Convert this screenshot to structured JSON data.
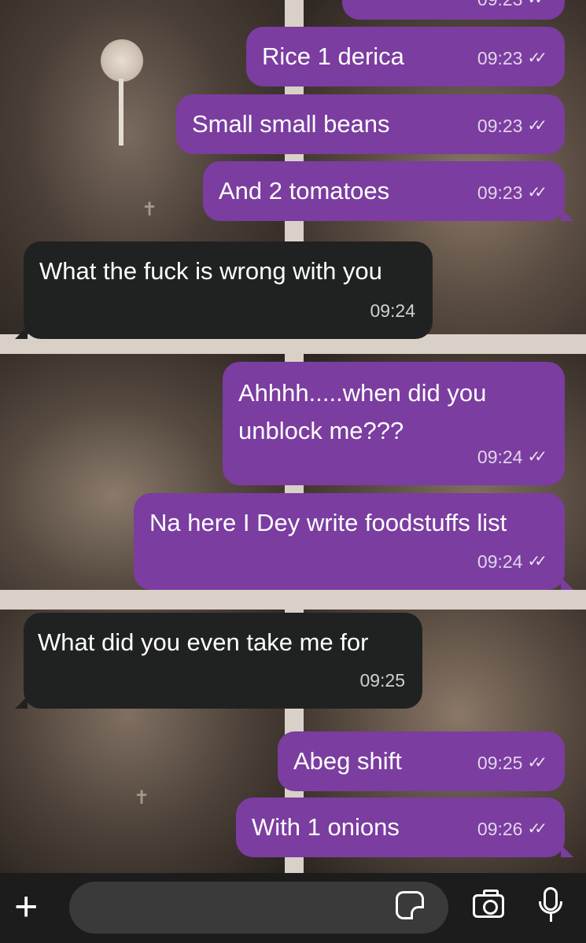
{
  "messages": [
    {
      "dir": "out",
      "text": "",
      "time": "09:23"
    },
    {
      "dir": "out",
      "text": "Rice 1 derica",
      "time": "09:23"
    },
    {
      "dir": "out",
      "text": "Small small beans",
      "time": "09:23"
    },
    {
      "dir": "out",
      "text": "And 2 tomatoes",
      "time": "09:23"
    },
    {
      "dir": "in",
      "text": "What the fuck is wrong with you",
      "time": "09:24"
    },
    {
      "dir": "out",
      "text": "Ahhhh.....when did you unblock me???",
      "time": "09:24"
    },
    {
      "dir": "out",
      "text": "Na here I Dey write foodstuffs list",
      "time": "09:24"
    },
    {
      "dir": "in",
      "text": "What did you even take me for",
      "time": "09:25"
    },
    {
      "dir": "out",
      "text": "Abeg shift",
      "time": "09:25"
    },
    {
      "dir": "out",
      "text": "With 1 onions",
      "time": "09:26"
    }
  ],
  "read_ticks": "✓✓",
  "composer": {
    "plus_icon": "plus-icon",
    "sticker_icon": "sticker-icon",
    "camera_icon": "camera-icon",
    "mic_icon": "microphone-icon",
    "plus_glyph": "+"
  },
  "colors": {
    "outgoing_bubble": "#7b3da0",
    "incoming_bubble": "#202221",
    "input_bar": "#1c1c1c"
  }
}
